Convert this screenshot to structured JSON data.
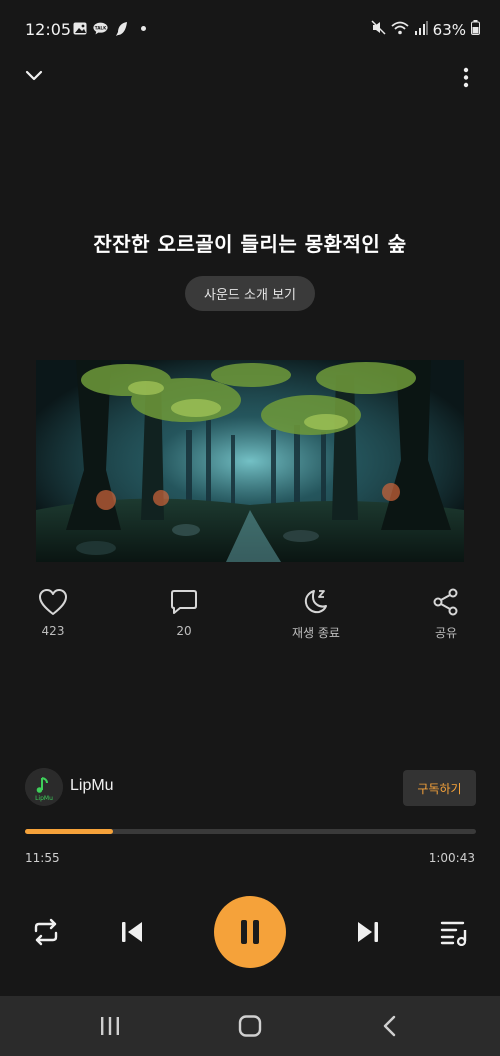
{
  "status_bar": {
    "time": "12:05",
    "battery": "63%",
    "icons_left": [
      "image-icon",
      "talk-icon",
      "feather-icon"
    ],
    "icons_right": [
      "mute-icon",
      "wifi-icon",
      "signal-icon",
      "battery-icon"
    ]
  },
  "header": {
    "title": "잔잔한 오르골이 들리는 몽환적인 숲",
    "sound_info_label": "사운드 소개 보기"
  },
  "actions": {
    "like_count": "423",
    "comment_count": "20",
    "sleep_timer_label": "재생 종료",
    "share_label": "공유"
  },
  "channel": {
    "name": "LipMu",
    "subscribe_label": "구독하기",
    "avatar_text": "LipMu"
  },
  "player": {
    "current_time": "11:55",
    "total_time": "1:00:43",
    "progress_fraction": 0.196,
    "state": "playing"
  },
  "colors": {
    "accent": "#f5a23a",
    "background": "#171717"
  },
  "icons": {
    "collapse": "chevron-down-icon",
    "more": "more-vertical-icon",
    "repeat": "repeat-icon",
    "previous": "skip-previous-icon",
    "pause": "pause-icon",
    "next": "skip-next-icon",
    "playlist": "playlist-icon"
  }
}
